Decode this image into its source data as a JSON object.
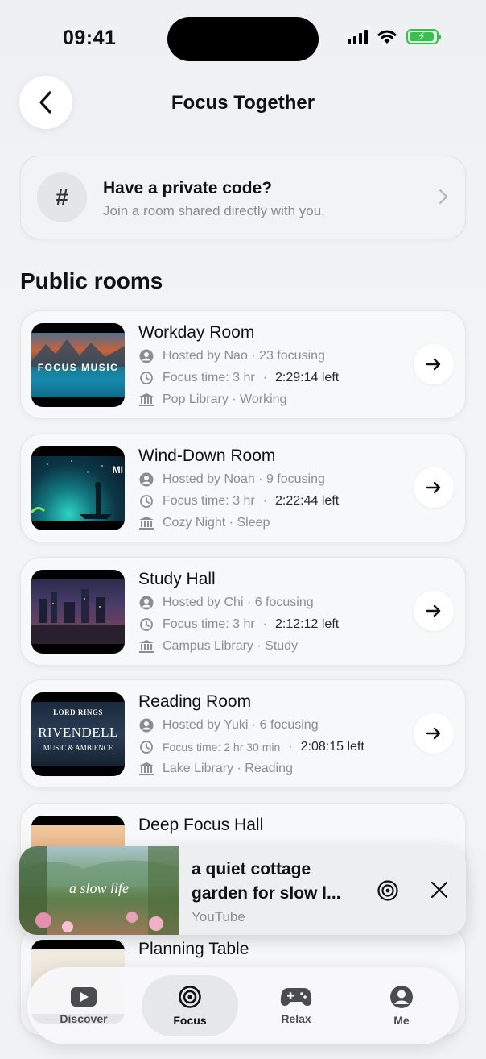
{
  "status_bar": {
    "time": "09:41"
  },
  "header": {
    "title": "Focus Together"
  },
  "private_code": {
    "title": "Have a private code?",
    "subtitle": "Join a room shared directly with you."
  },
  "section_title": "Public rooms",
  "rooms": [
    {
      "name": "Workday Room",
      "host": "Hosted by Nao · 23 focusing",
      "focus_time": "Focus time: 3 hr",
      "sep": "·",
      "left": "2:29:14 left",
      "library": "Pop Library · Working",
      "thumb_text": "FOCUS MUSIC"
    },
    {
      "name": "Wind-Down Room",
      "host": "Hosted by Noah · 9 focusing",
      "focus_time": "Focus time: 3 hr",
      "sep": "·",
      "left": "2:22:44 left",
      "library": "Cozy Night · Sleep",
      "thumb_text": "MI"
    },
    {
      "name": "Study Hall",
      "host": "Hosted by Chi · 6 focusing",
      "focus_time": "Focus time: 3 hr",
      "sep": "·",
      "left": "2:12:12 left",
      "library": "Campus Library · Study",
      "thumb_text": ""
    },
    {
      "name": "Reading Room",
      "host": "Hosted by Yuki · 6 focusing",
      "focus_time": "Focus time: 2 hr 30 min",
      "sep": "·",
      "left": "2:08:15 left",
      "library": "Lake Library · Reading",
      "thumb_text": "RIVENDELL",
      "thumb_top": "LORD RINGS",
      "thumb_sub": "MUSIC & AMBIENCE"
    },
    {
      "name": "Deep Focus Hall"
    },
    {
      "name": "Planning Table"
    }
  ],
  "mini_player": {
    "title": "a quiet cottage garden for slow l...",
    "source": "YouTube",
    "thumb_text": "a slow life"
  },
  "tabs": [
    {
      "label": "Discover",
      "icon": "play-icon"
    },
    {
      "label": "Focus",
      "icon": "target-icon",
      "active": true
    },
    {
      "label": "Relax",
      "icon": "gamepad-icon"
    },
    {
      "label": "Me",
      "icon": "person-icon"
    }
  ],
  "colors": {
    "accent_green": "#36c24b",
    "muted_text": "#8a8d92"
  }
}
